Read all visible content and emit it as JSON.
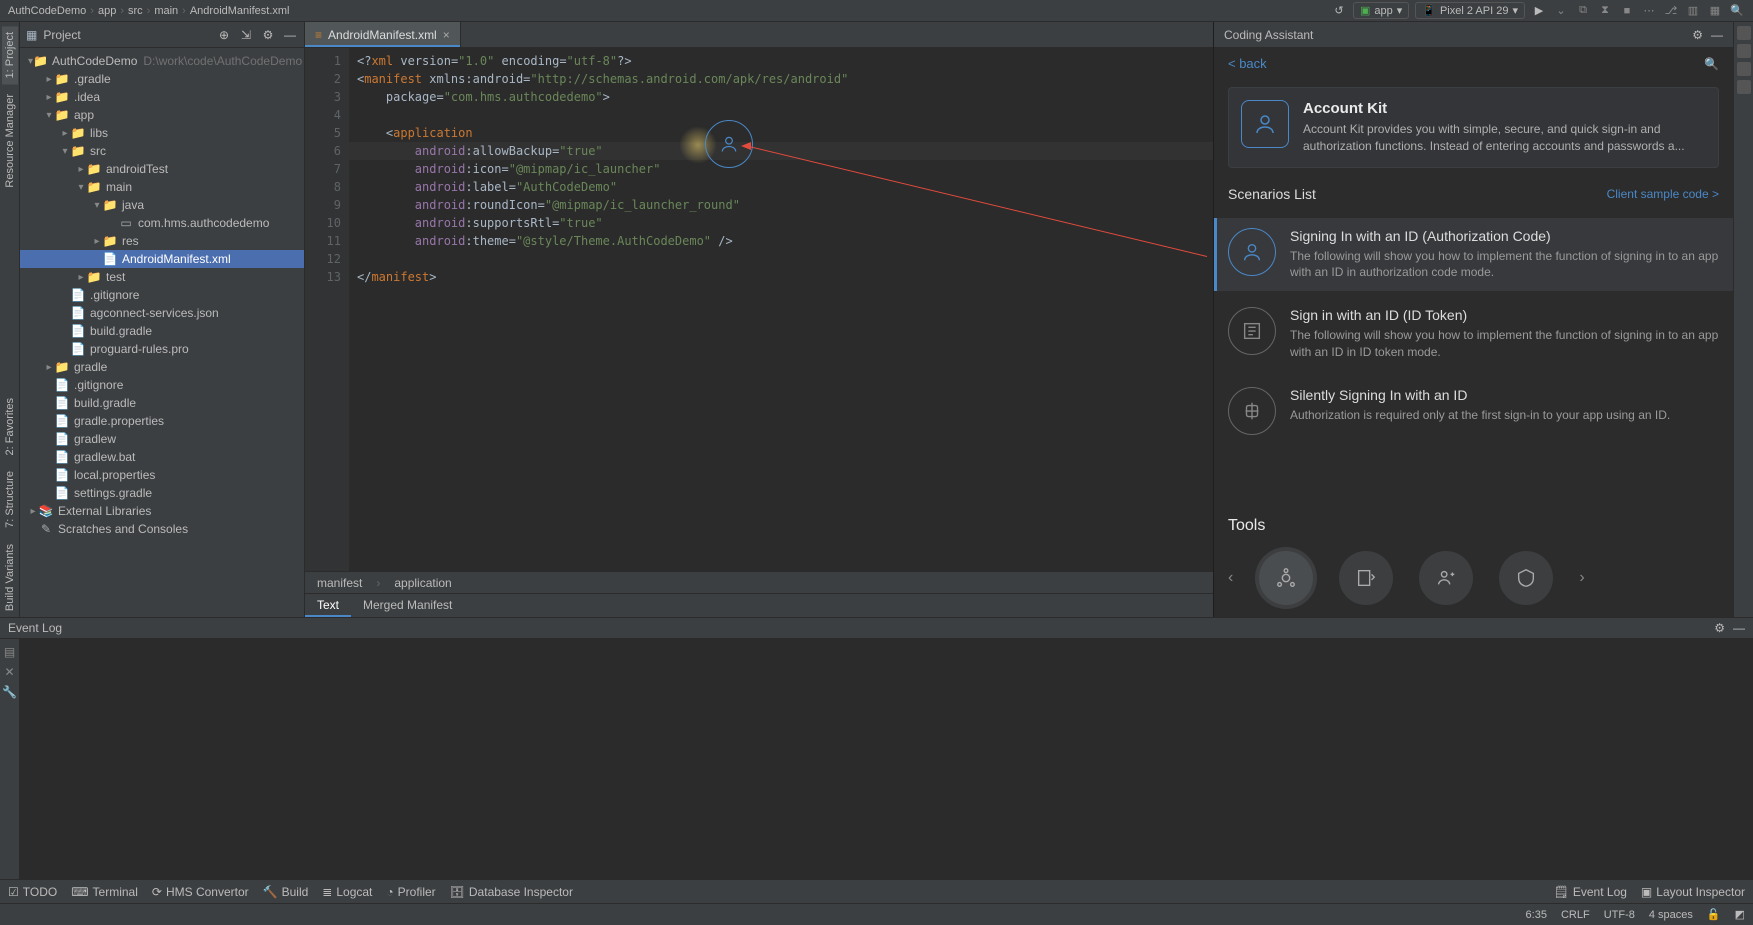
{
  "breadcrumbs": [
    "AuthCodeDemo",
    "app",
    "src",
    "main",
    "AndroidManifest.xml"
  ],
  "run": {
    "config_label": "app",
    "device_label": "Pixel 2 API 29"
  },
  "project": {
    "header": "Project",
    "tree": [
      {
        "depth": 0,
        "arrow": "▾",
        "icon": "module",
        "label": "AuthCodeDemo",
        "muted": "D:\\work\\code\\AuthCodeDemo"
      },
      {
        "depth": 1,
        "arrow": "▸",
        "icon": "folder",
        "label": ".gradle"
      },
      {
        "depth": 1,
        "arrow": "▸",
        "icon": "folder",
        "label": ".idea"
      },
      {
        "depth": 1,
        "arrow": "▾",
        "icon": "module",
        "label": "app"
      },
      {
        "depth": 2,
        "arrow": "▸",
        "icon": "folder",
        "label": "libs"
      },
      {
        "depth": 2,
        "arrow": "▾",
        "icon": "folder",
        "label": "src"
      },
      {
        "depth": 3,
        "arrow": "▸",
        "icon": "folder",
        "label": "androidTest"
      },
      {
        "depth": 3,
        "arrow": "▾",
        "icon": "folder",
        "label": "main"
      },
      {
        "depth": 4,
        "arrow": "▾",
        "icon": "folder",
        "label": "java"
      },
      {
        "depth": 5,
        "arrow": "",
        "icon": "pkg",
        "label": "com.hms.authcodedemo"
      },
      {
        "depth": 4,
        "arrow": "▸",
        "icon": "folder",
        "label": "res"
      },
      {
        "depth": 4,
        "arrow": "",
        "icon": "file",
        "label": "AndroidManifest.xml",
        "selected": true
      },
      {
        "depth": 3,
        "arrow": "▸",
        "icon": "folder",
        "label": "test"
      },
      {
        "depth": 2,
        "arrow": "",
        "icon": "file",
        "label": ".gitignore"
      },
      {
        "depth": 2,
        "arrow": "",
        "icon": "file",
        "label": "agconnect-services.json"
      },
      {
        "depth": 2,
        "arrow": "",
        "icon": "file",
        "label": "build.gradle"
      },
      {
        "depth": 2,
        "arrow": "",
        "icon": "file",
        "label": "proguard-rules.pro"
      },
      {
        "depth": 1,
        "arrow": "▸",
        "icon": "folder",
        "label": "gradle"
      },
      {
        "depth": 1,
        "arrow": "",
        "icon": "file",
        "label": ".gitignore"
      },
      {
        "depth": 1,
        "arrow": "",
        "icon": "file",
        "label": "build.gradle"
      },
      {
        "depth": 1,
        "arrow": "",
        "icon": "file",
        "label": "gradle.properties"
      },
      {
        "depth": 1,
        "arrow": "",
        "icon": "file",
        "label": "gradlew"
      },
      {
        "depth": 1,
        "arrow": "",
        "icon": "file",
        "label": "gradlew.bat"
      },
      {
        "depth": 1,
        "arrow": "",
        "icon": "file",
        "label": "local.properties"
      },
      {
        "depth": 1,
        "arrow": "",
        "icon": "file",
        "label": "settings.gradle"
      },
      {
        "depth": 0,
        "arrow": "▸",
        "icon": "lib",
        "label": "External Libraries"
      },
      {
        "depth": 0,
        "arrow": "",
        "icon": "scratch",
        "label": "Scratches and Consoles"
      }
    ]
  },
  "left_tabs": [
    "1: Project",
    "Resource Manager"
  ],
  "left_tabs2": [
    "2: Favorites",
    "7: Structure",
    "Build Variants"
  ],
  "editor": {
    "tab_label": "AndroidManifest.xml",
    "lines": [
      "<?xml version=\"1.0\" encoding=\"utf-8\"?>",
      "<manifest xmlns:android=\"http://schemas.android.com/apk/res/android\"",
      "    package=\"com.hms.authcodedemo\">",
      "",
      "    <application",
      "        android:allowBackup=\"true\"",
      "        android:icon=\"@mipmap/ic_launcher\"",
      "        android:label=\"AuthCodeDemo\"",
      "        android:roundIcon=\"@mipmap/ic_launcher_round\"",
      "        android:supportsRtl=\"true\"",
      "        android:theme=\"@style/Theme.AuthCodeDemo\" />",
      "",
      "</manifest>"
    ],
    "crumb": [
      "manifest",
      "application"
    ],
    "sub_tabs": [
      "Text",
      "Merged Manifest"
    ]
  },
  "assistant": {
    "title": "Coding Assistant",
    "back": "< back",
    "kit": {
      "title": "Account Kit",
      "desc": "Account Kit provides you with simple, secure, and quick sign-in and authorization functions. Instead of entering accounts and passwords a..."
    },
    "scenarios_label": "Scenarios List",
    "scenarios_link": "Client sample code >",
    "scenarios": [
      {
        "title": "Signing In with an ID (Authorization Code)",
        "desc": "The following will show you how to implement the function of signing in to an app with an ID in authorization code mode.",
        "active": true,
        "muted": false
      },
      {
        "title": "Sign in with an ID (ID Token)",
        "desc": "The following will show you how to implement the function of signing in to an app with an ID in ID token mode.",
        "active": false,
        "muted": true
      },
      {
        "title": "Silently Signing In with an ID",
        "desc": "Authorization is required only at the first sign-in to your app using an ID.",
        "active": false,
        "muted": true
      }
    ],
    "tools_label": "Tools"
  },
  "event_log": {
    "title": "Event Log"
  },
  "bottom": {
    "items_left": [
      "TODO",
      "Terminal",
      "HMS Convertor",
      "Build",
      "Logcat",
      "Profiler",
      "Database Inspector"
    ],
    "items_right": [
      "Event Log",
      "Layout Inspector"
    ]
  },
  "status": {
    "pos": "6:35",
    "eol": "CRLF",
    "enc": "UTF-8",
    "indent": "4 spaces"
  }
}
